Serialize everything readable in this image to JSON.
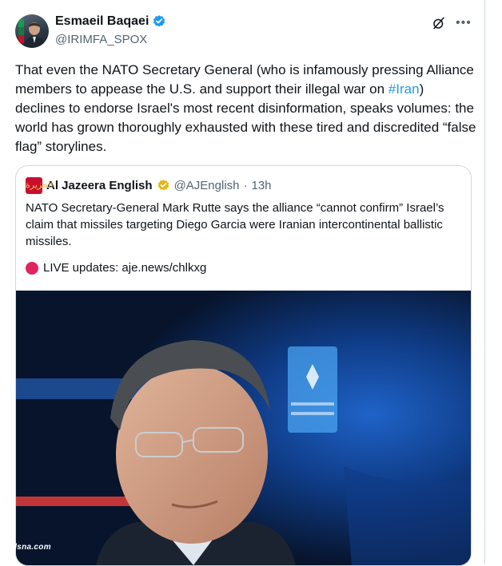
{
  "author": {
    "display_name": "Esmaeil Baqaei",
    "handle": "@IRIMFA_SPOX"
  },
  "icons": {
    "verified": "verified-badge-icon",
    "grok": "grok-icon",
    "more": "more-options-icon"
  },
  "tweet": {
    "text_before": "That even the NATO Secretary General (who is infamously pressing Alliance members to appease the U.S. and support their illegal war on ",
    "hashtag": "#Iran",
    "text_after": ") declines to endorse Israel's most recent disinformation, speaks volumes: the world has grown thoroughly exhausted with these tired and discredited “false flag” storylines."
  },
  "quote": {
    "display_name": "Al Jazeera English",
    "handle": "@AJEnglish",
    "separator": "·",
    "time": "13h",
    "text": "NATO Secretary-General Mark Rutte says the alliance “cannot confirm” Israel’s claim that missiles targeting Diego Garcia were Iranian intercontinental ballistic missiles.",
    "live_text": "LIVE updates: aje.news/chlkxg",
    "logo_text": "الجزيرة"
  },
  "watermark": "qodsna.com",
  "colors": {
    "link": "#1d9bf0",
    "verified_blue": "#1d9bf0",
    "gold_badge": "#e2b719",
    "aj_red": "#c8102e",
    "live_red": "#e0245e"
  }
}
